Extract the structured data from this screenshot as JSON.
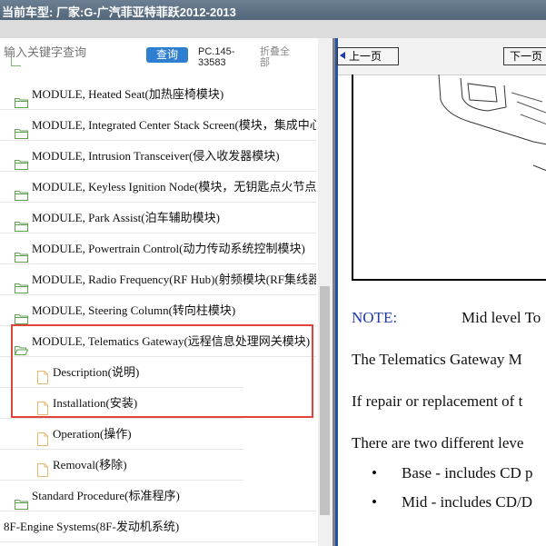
{
  "title_bar": {
    "text": "当前车型:  厂家:G-广汽菲亚特菲跃2012-2013"
  },
  "left_panel": {
    "search": {
      "placeholder": "输入关键字查询",
      "query_button": "查询"
    },
    "pc_code": "PC.145-33583",
    "collapse_all": "折叠全部",
    "tree": [
      {
        "label": "MODULE, Heated Seat(加热座椅模块)",
        "type": "folder"
      },
      {
        "label": "MODULE, Integrated Center Stack Screen(模块，集成中心…",
        "type": "folder"
      },
      {
        "label": "MODULE, Intrusion Transceiver(侵入收发器模块)",
        "type": "folder"
      },
      {
        "label": "MODULE, Keyless Ignition Node(模块，无钥匙点火节点",
        "type": "folder"
      },
      {
        "label": "MODULE, Park Assist(泊车辅助模块)",
        "type": "folder"
      },
      {
        "label": "MODULE, Powertrain Control(动力传动系统控制模块)",
        "type": "folder"
      },
      {
        "label": "MODULE, Radio Frequency(RF Hub)(射频模块(RF集线器",
        "type": "folder"
      },
      {
        "label": "MODULE, Steering Column(转向柱模块)",
        "type": "folder"
      },
      {
        "label": "MODULE, Telematics Gateway(远程信息处理网关模块)",
        "type": "folder-open"
      },
      {
        "label": "Description(说明)",
        "type": "page"
      },
      {
        "label": "Installation(安装)",
        "type": "page"
      },
      {
        "label": "Operation(操作)",
        "type": "page"
      },
      {
        "label": "Removal(移除)",
        "type": "page"
      },
      {
        "label": "Standard Procedure(标准程序)",
        "type": "folder"
      },
      {
        "label": "8F-Engine Systems(8F-发动机系统)",
        "type": "none"
      }
    ]
  },
  "right_panel": {
    "prev_button": "上一页",
    "next_button": "下一页",
    "note_label": "NOTE:",
    "note_text": "Mid level To",
    "paragraphs": [
      "The Telematics Gateway M",
      "If repair or replacement of t",
      "There are two different leve"
    ],
    "bullets": [
      "Base - includes CD p",
      "Mid - includes CD/D"
    ]
  },
  "colors": {
    "accent": "#2f7fd0",
    "highlight": "#e0443a",
    "folder": "#7db36c",
    "page_icon": "#e8b770"
  }
}
